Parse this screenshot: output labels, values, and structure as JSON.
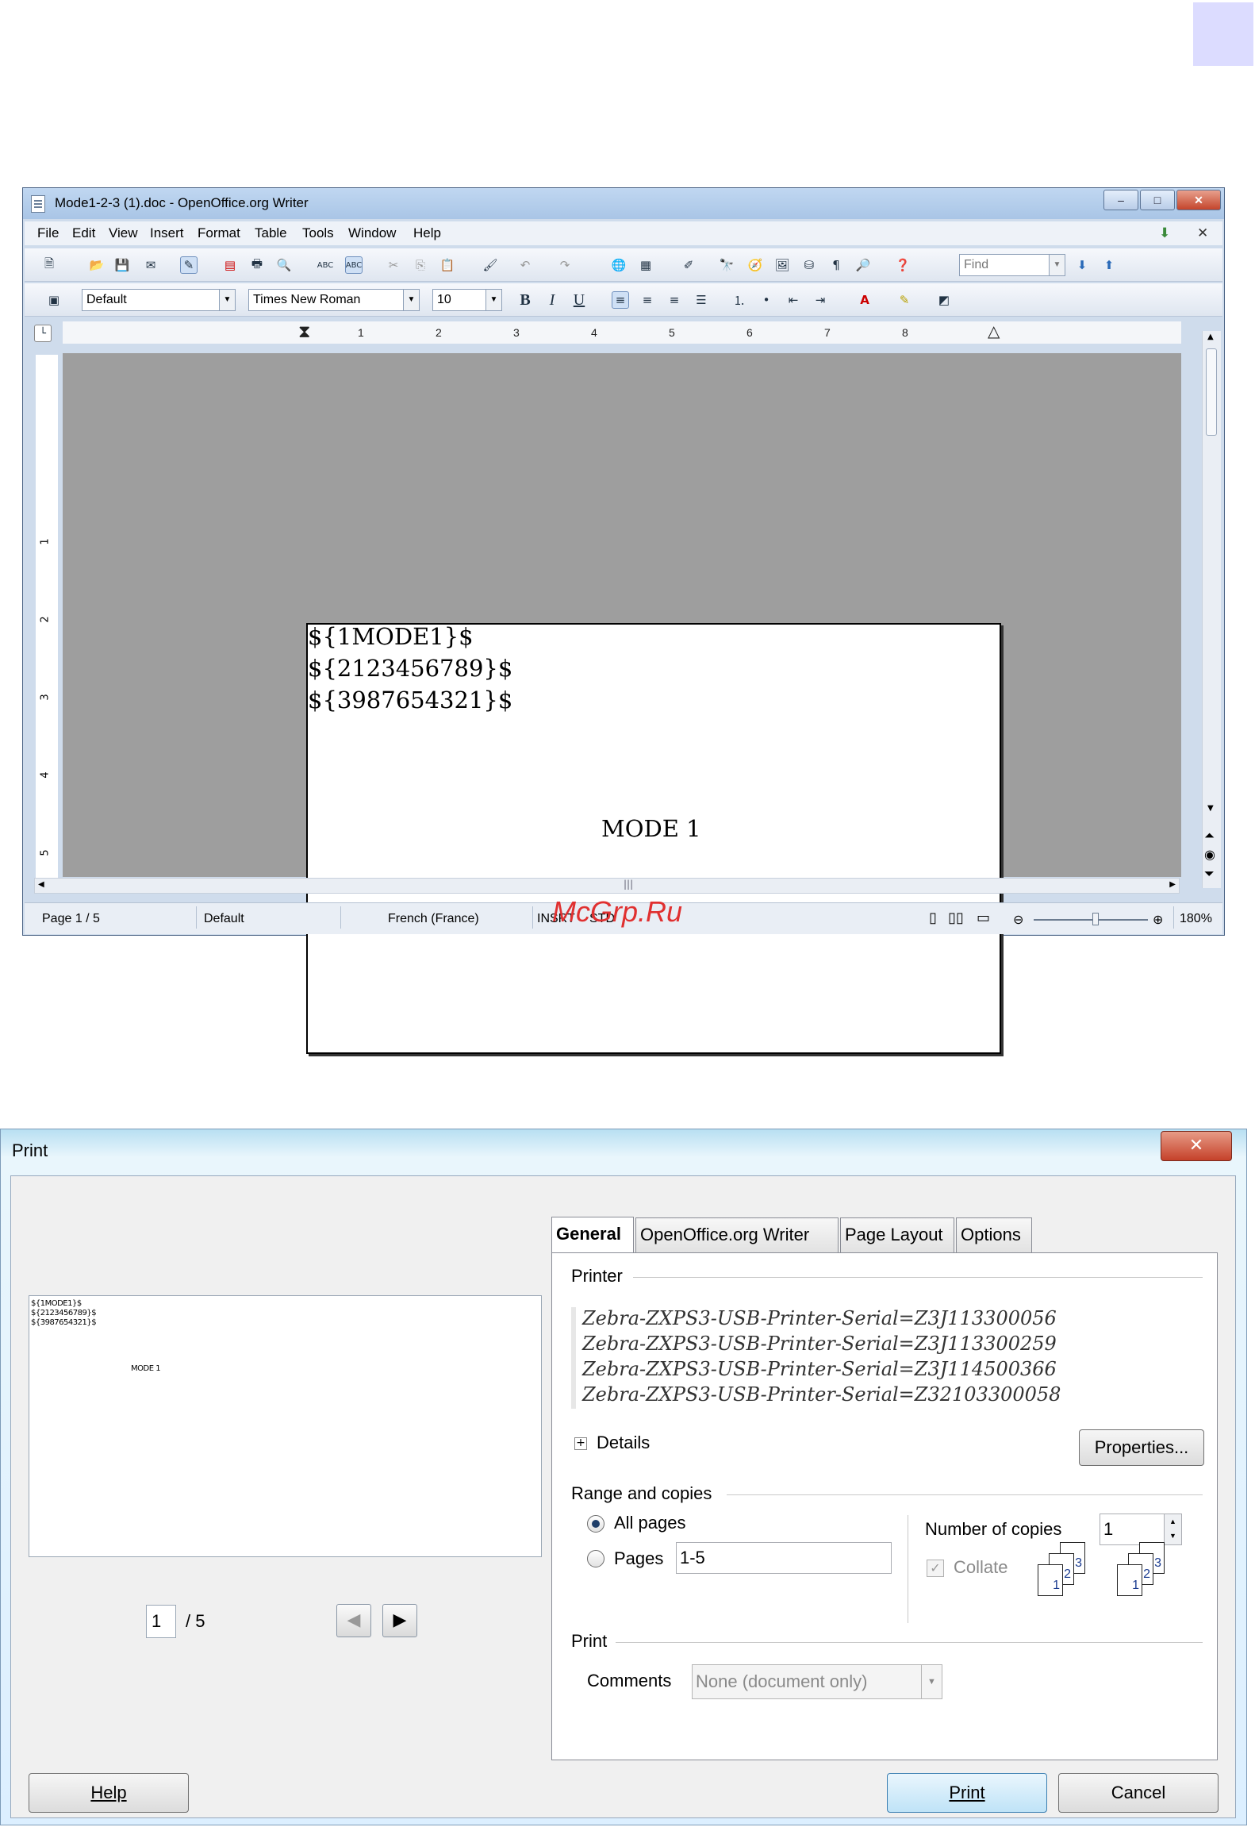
{
  "writer": {
    "title": "Mode1-2-3 (1).doc - OpenOffice.org Writer",
    "window_controls": {
      "minimize": "–",
      "maximize": "□",
      "close": "✕"
    },
    "menu": [
      "File",
      "Edit",
      "View",
      "Insert",
      "Format",
      "Table",
      "Tools",
      "Window",
      "Help"
    ],
    "toolbar": {
      "paragraph_style": "Default",
      "font_name": "Times New Roman",
      "font_size": "10",
      "find_placeholder": "Find",
      "bold": "B",
      "italic": "I",
      "underline": "U"
    },
    "ruler_ticks": [
      "1",
      "2",
      "3",
      "4",
      "5",
      "6",
      "7",
      "8"
    ],
    "vruler_ticks": [
      "1",
      "2",
      "3",
      "4",
      "5"
    ],
    "document": {
      "lines": [
        "${1MODE1}$",
        "${2123456789}$",
        "${3987654321}$"
      ],
      "center_text": "MODE 1"
    },
    "status": {
      "page": "Page 1 / 5",
      "style": "Default",
      "language": "French (France)",
      "insert": "INSRT",
      "selection": "STD",
      "zoom": "180%"
    }
  },
  "watermark": "McGrp.Ru",
  "print_dialog": {
    "title": "Print",
    "close": "✕",
    "preview": {
      "lines": [
        "${1MODE1}$",
        "${2123456789}$",
        "${3987654321}$"
      ],
      "center_text": "MODE 1",
      "page_current": "1",
      "page_total": "/ 5"
    },
    "tabs": [
      "General",
      "OpenOffice.org Writer",
      "Page Layout",
      "Options"
    ],
    "printer": {
      "group_label": "Printer",
      "list": [
        "Zebra-ZXPS3-USB-Printer-Serial=Z3J113300056",
        "Zebra-ZXPS3-USB-Printer-Serial=Z3J113300259",
        "Zebra-ZXPS3-USB-Printer-Serial=Z3J114500366",
        "Zebra-ZXPS3-USB-Printer-Serial=Z32103300058"
      ],
      "details_label": "Details",
      "properties_label": "Properties..."
    },
    "range": {
      "group_label": "Range and copies",
      "all_pages": "All pages",
      "pages": "Pages",
      "pages_value": "1-5",
      "copies_label": "Number of copies",
      "copies_value": "1",
      "collate": "Collate"
    },
    "print_group": {
      "group_label": "Print",
      "comments_label": "Comments",
      "comments_value": "None (document only)"
    },
    "buttons": {
      "help": "Help",
      "print": "Print",
      "cancel": "Cancel"
    }
  }
}
